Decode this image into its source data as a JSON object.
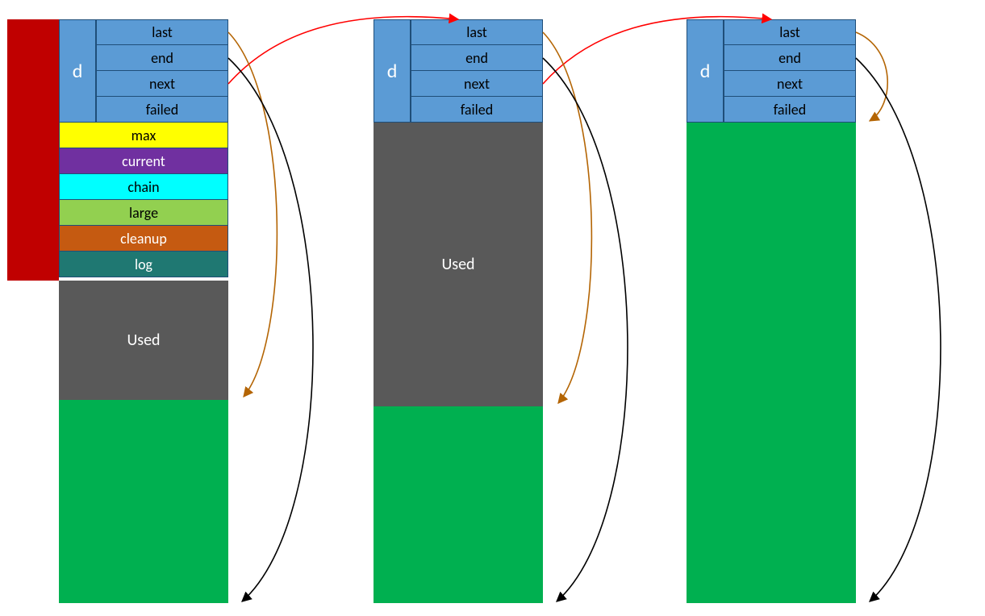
{
  "header": {
    "d_label": "d",
    "fields": [
      "last",
      "end",
      "next",
      "failed"
    ]
  },
  "properties": {
    "max": "max",
    "current": "current",
    "chain": "chain",
    "large": "large",
    "cleanup": "cleanup",
    "log": "log"
  },
  "blocks": {
    "used_label": "Used"
  },
  "columns": {
    "count": 3,
    "layout": [
      {
        "has_red_sidebar": true,
        "has_properties": true,
        "used_visible": true
      },
      {
        "has_red_sidebar": false,
        "has_properties": false,
        "used_visible": true
      },
      {
        "has_red_sidebar": false,
        "has_properties": false,
        "used_visible": false
      }
    ]
  },
  "colors": {
    "header_fill": "#5b9bd5",
    "header_border": "#1f4e79",
    "red_sidebar": "#c00000",
    "yellow": "#ffff00",
    "purple": "#7030a0",
    "cyan": "#00ffff",
    "olive": "#92d050",
    "brown": "#c55a11",
    "teal": "#1f7872",
    "used": "#595959",
    "free": "#00b050",
    "arrow_next": "#ff0000",
    "arrow_last": "#b46504",
    "arrow_end": "#000000"
  },
  "arrows": {
    "description": "Red arrows chain d.next from one block's header to the next block's header. Orange arrows point d.last to the first free (green) position. Black arrows point d.end to the bottom of each block.",
    "kinds": [
      "next_red",
      "last_orange",
      "end_black"
    ]
  }
}
